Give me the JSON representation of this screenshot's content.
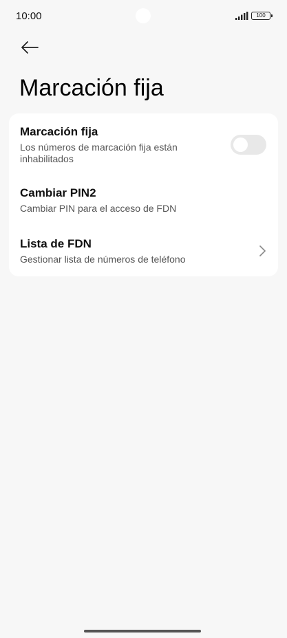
{
  "status_bar": {
    "time": "10:00",
    "battery": "100",
    "signal_icon": "signal-bars-icon",
    "battery_icon": "battery-icon"
  },
  "header": {
    "back_icon": "arrow-left-icon",
    "title": "Marcación fija"
  },
  "settings": {
    "fdn_toggle": {
      "title": "Marcación fija",
      "subtitle": "Los números de marcación fija están inhabilitados",
      "enabled": false
    },
    "change_pin2": {
      "title": "Cambiar PIN2",
      "subtitle": "Cambiar PIN para el acceso de FDN"
    },
    "fdn_list": {
      "title": "Lista de FDN",
      "subtitle": "Gestionar lista de números de teléfono",
      "icon": "chevron-right-icon"
    }
  }
}
